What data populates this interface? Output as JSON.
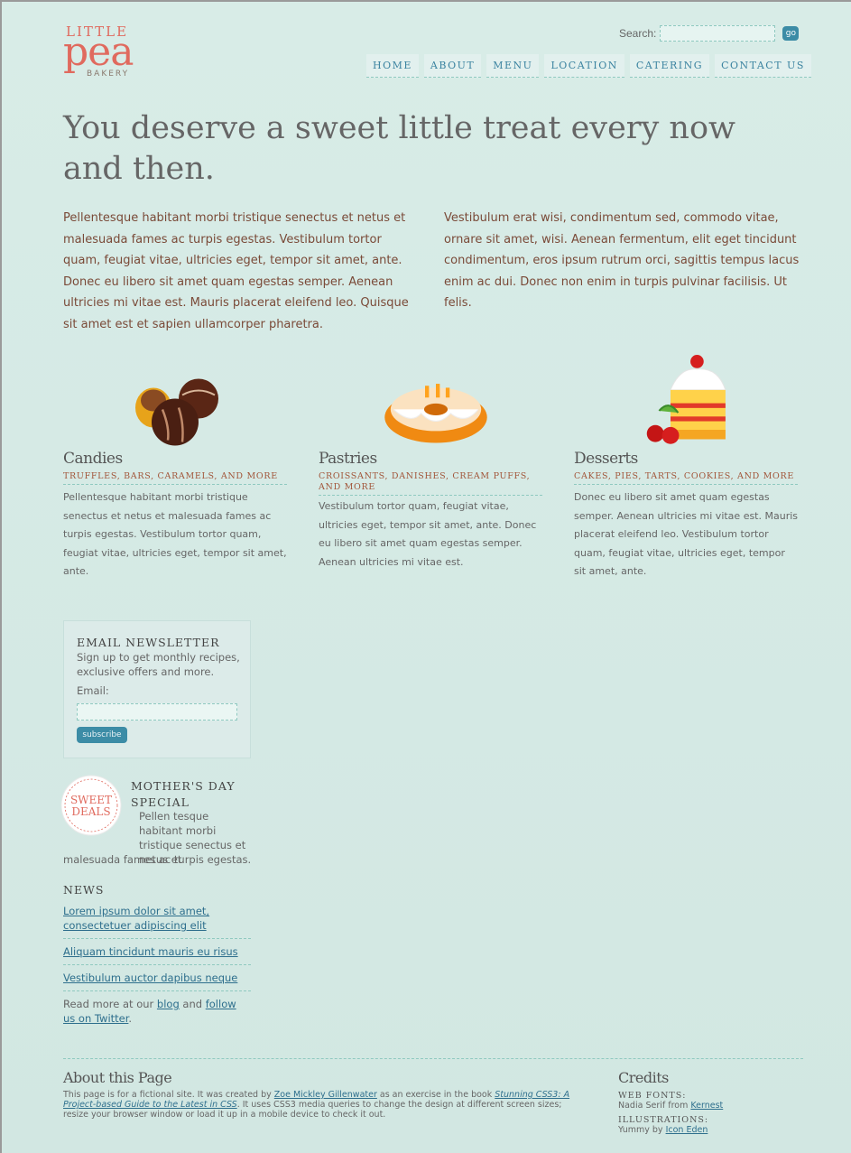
{
  "logo": {
    "little": "LITTLE",
    "pea": "pea",
    "bakery": "BAKERY"
  },
  "search": {
    "label": "Search:",
    "value": "",
    "button": "go"
  },
  "nav": [
    "HOME",
    "ABOUT",
    "MENU",
    "LOCATION",
    "CATERING",
    "CONTACT US"
  ],
  "headline": "You deserve a sweet little treat every now and then.",
  "intro": {
    "left": "Pellentesque habitant morbi tristique senectus et netus et malesuada fames ac turpis egestas. Vestibulum tortor quam, feugiat vitae, ultricies eget, tempor sit amet, ante. Donec eu libero sit amet quam egestas semper. Aenean ultricies mi vitae est. Mauris placerat eleifend leo. Quisque sit amet est et sapien ullamcorper pharetra.",
    "right": "Vestibulum erat wisi, condimentum sed, commodo vitae, ornare sit amet, wisi. Aenean fermentum, elit eget tincidunt condimentum, eros ipsum rutrum orci, sagittis tempus lacus enim ac dui. Donec non enim in turpis pulvinar facilisis. Ut felis."
  },
  "products": [
    {
      "title": "Candies",
      "subtitle": "TRUFFLES, BARS, CARAMELS, AND MORE",
      "text": "Pellentesque habitant morbi tristique senectus et netus et malesuada fames ac turpis egestas. Vestibulum tortor quam, feugiat vitae, ultricies eget, tempor sit amet, ante."
    },
    {
      "title": "Pastries",
      "subtitle": "CROISSANTS, DANISHES, CREAM PUFFS, AND MORE",
      "text": "Vestibulum tortor quam, feugiat vitae, ultricies eget, tempor sit amet, ante. Donec eu libero sit amet quam egestas semper. Aenean ultricies mi vitae est."
    },
    {
      "title": "Desserts",
      "subtitle": "CAKES, PIES, TARTS, COOKIES, AND MORE",
      "text": "Donec eu libero sit amet quam egestas semper. Aenean ultricies mi vitae est. Mauris placerat eleifend leo. Vestibulum tortor quam, feugiat vitae, ultricies eget, tempor sit amet, ante."
    }
  ],
  "newsletter": {
    "title": "EMAIL NEWSLETTER",
    "desc": "Sign up to get monthly recipes, exclusive offers and more.",
    "email_label": "Email:",
    "email_value": "",
    "button": "subscribe"
  },
  "sweet_deals": {
    "line1": "SWEET",
    "line2": "DEALS"
  },
  "mothers_day": {
    "title": "MOTHER'S DAY SPECIAL",
    "text1": "Pellen tesque habitant morbi tristique senectus et netus et",
    "text2": "malesuada fames ac turpis egestas."
  },
  "news": {
    "title": "NEWS",
    "items": [
      "Lorem ipsum dolor sit amet, consectetuer adipiscing elit",
      "Aliquam tincidunt mauris eu risus",
      "Vestibulum auctor dapibus neque"
    ],
    "readmore_pre": "Read more at our ",
    "blog": "blog",
    "and": " and ",
    "follow": "follow us on Twitter",
    "end": "."
  },
  "about": {
    "title": "About this Page",
    "t1": "This page is for a fictional site. It was created by ",
    "author": "Zoe Mickley Gillenwater",
    "t2": " as an exercise in the book ",
    "book": "Stunning CSS3: A Project-based Guide to the Latest in CSS",
    "t3": ". It uses CSS3 media queries to change the design at different screen sizes; resize your browser window or load it up in a mobile device to check it out."
  },
  "credits": {
    "title": "Credits",
    "web_fonts_label": "WEB FONTS:",
    "web_fonts_pre": "Nadia Serif from ",
    "web_fonts_link": "Kernest",
    "illustrations_label": "ILLUSTRATIONS:",
    "illustrations_pre": "Yummy by ",
    "illustrations_link": "Icon Eden"
  }
}
